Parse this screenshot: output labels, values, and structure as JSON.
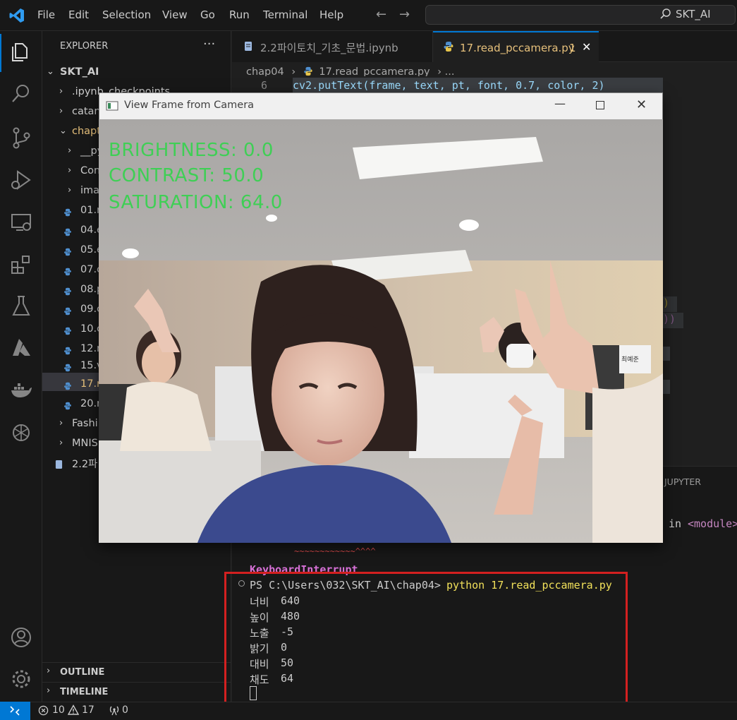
{
  "menu": [
    "File",
    "Edit",
    "Selection",
    "View",
    "Go",
    "Run",
    "Terminal",
    "Help"
  ],
  "search": {
    "text": "SKT_AI"
  },
  "explorer": {
    "title": "EXPLORER",
    "more": "···",
    "root": "SKT_AI",
    "items": [
      {
        "label": ".ipynb_checkpoints"
      },
      {
        "label": "catan"
      },
      {
        "label": "chapt"
      },
      {
        "label": "__py"
      },
      {
        "label": "Conv"
      },
      {
        "label": "ima"
      },
      {
        "label": "01.r"
      },
      {
        "label": "04.e"
      },
      {
        "label": "05.e"
      },
      {
        "label": "07.c"
      },
      {
        "label": "08.p"
      },
      {
        "label": "09.c"
      },
      {
        "label": "10.c"
      },
      {
        "label": "12.r"
      },
      {
        "label": "15.v"
      },
      {
        "label": "17.r"
      },
      {
        "label": "20.r"
      },
      {
        "label": "Fashi"
      },
      {
        "label": "MNIS"
      },
      {
        "label": "2.2파"
      }
    ],
    "outline": "OUTLINE",
    "timeline": "TIMELINE"
  },
  "tabs": [
    {
      "label": "2.2파이토치_기초_문법.ipynb"
    },
    {
      "label": "17.read_pccamera.py",
      "badge": "1",
      "close": "✕"
    }
  ],
  "breadcrumb": {
    "folder": "chap04",
    "sep": "›",
    "file": "17.read_pccamera.py",
    "rest": "› ..."
  },
  "editor": {
    "line_number": "6",
    "code": "cv2.putText(frame, text, pt, font, 0.7, color, 2)"
  },
  "panel": {
    "jupyter_tab": "JUPYTER",
    "right_line_in": "in",
    "right_line_module": "<module>",
    "squiggle": "~~~~~~~~~~~~^^^^",
    "interrupt": "KeyboardInterrupt",
    "prompt": "PS C:\\Users\\032\\SKT_AI\\chap04>",
    "command": "python 17.read_pccamera.py",
    "output": [
      {
        "k": "너비",
        "v": "640"
      },
      {
        "k": "높이",
        "v": "480"
      },
      {
        "k": "노출",
        "v": "-5"
      },
      {
        "k": "밝기",
        "v": "0"
      },
      {
        "k": "대비",
        "v": "50"
      },
      {
        "k": "채도",
        "v": "64"
      }
    ]
  },
  "status": {
    "errors": "10",
    "warnings": "17",
    "ports": "0"
  },
  "camera_window": {
    "title": "View Frame from Camera",
    "overlay": [
      "BRIGHTNESS: 0.0",
      "CONTRAST: 50.0",
      "SATURATION: 64.0"
    ],
    "overlay_color": "#3fcf55",
    "nameplate": "최예준"
  },
  "colors": {
    "accent": "#0078d4",
    "highlight_box": "#d32020"
  }
}
